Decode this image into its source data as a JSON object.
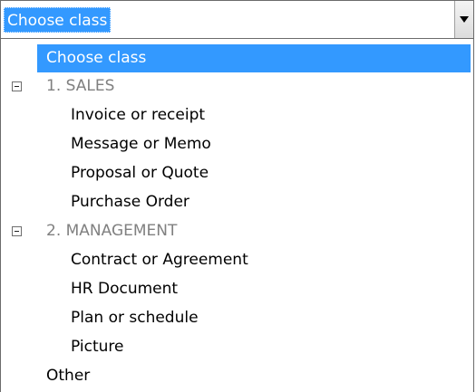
{
  "combo": {
    "value": "Choose class",
    "button_icon": "chevron-down-icon"
  },
  "dropdown": {
    "placeholder_item": "Choose class",
    "groups": [
      {
        "label": "1. SALES",
        "expander_icon": "collapse-minus-icon",
        "items": [
          "Invoice or receipt",
          "Message or Memo",
          "Proposal or Quote",
          "Purchase Order"
        ]
      },
      {
        "label": "2. MANAGEMENT",
        "expander_icon": "collapse-minus-icon",
        "items": [
          "Contract or Agreement",
          "HR Document",
          "Plan or schedule",
          "Picture"
        ]
      }
    ],
    "other_item": "Other"
  },
  "colors": {
    "selection": "#3399ff",
    "group_text": "#808080"
  }
}
